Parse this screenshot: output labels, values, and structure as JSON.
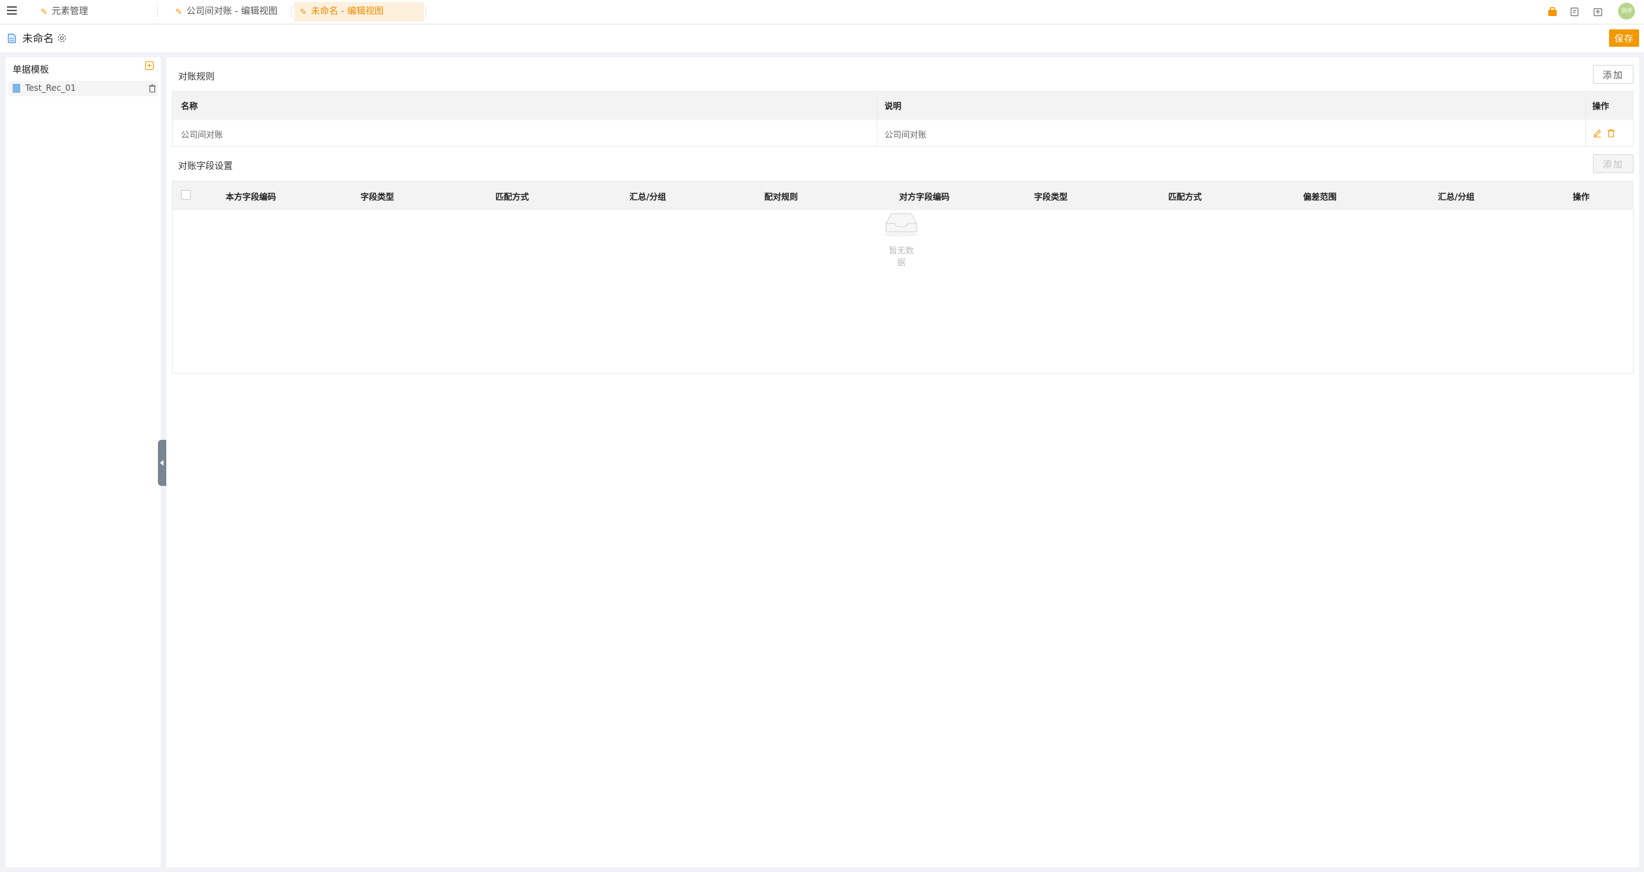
{
  "tabs": [
    {
      "label": "元素管理",
      "active": false
    },
    {
      "label": "公司间对账 - 编辑视图",
      "active": false
    },
    {
      "label": "未命名 - 编辑视图",
      "active": true
    }
  ],
  "header": {
    "title": "未命名",
    "save_label": "保存",
    "avatar_text": "测评"
  },
  "sidebar": {
    "title": "单据模板",
    "items": [
      {
        "label": "Test_Rec_01"
      }
    ]
  },
  "rules": {
    "title": "对账规则",
    "add_label": "添加",
    "columns": [
      "名称",
      "说明",
      "操作"
    ],
    "rows": [
      {
        "name": "公司间对账",
        "desc": "公司间对账"
      }
    ]
  },
  "fields": {
    "title": "对账字段设置",
    "add_label": "添加",
    "columns": [
      "本方字段编码",
      "字段类型",
      "匹配方式",
      "汇总/分组",
      "配对规则",
      "对方字段编码",
      "字段类型",
      "匹配方式",
      "偏差范围",
      "汇总/分组",
      "操作"
    ],
    "empty_text": "暂无数据"
  },
  "colors": {
    "accent": "#f39800",
    "active_tab_bg": "#fdf0dd"
  },
  "icons": [
    "menu-icon",
    "pin-icon",
    "briefcase-icon",
    "form-icon",
    "export-icon",
    "document-icon",
    "gear-icon",
    "add-square-icon",
    "trash-icon",
    "edit-icon",
    "inbox-icon",
    "chevron-left-icon"
  ]
}
